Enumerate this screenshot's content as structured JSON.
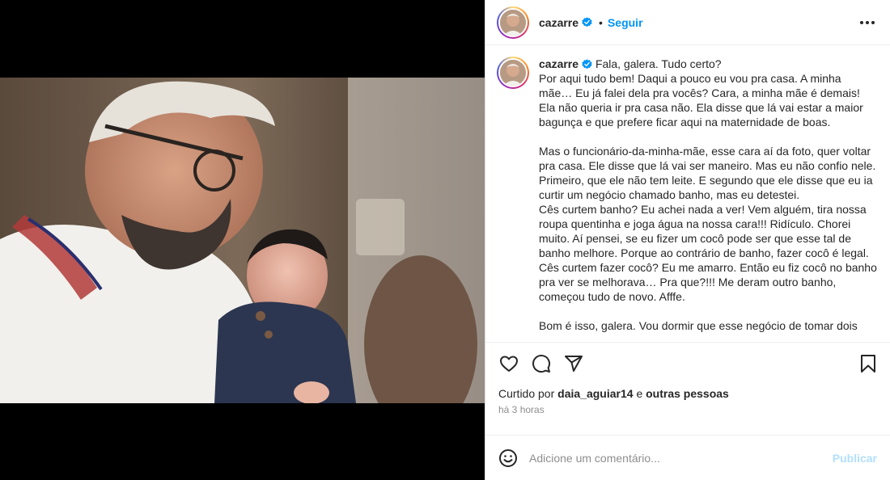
{
  "post": {
    "username": "cazarre",
    "follow_label": "Seguir",
    "separator": "•",
    "caption_username": "cazarre",
    "caption_lines": [
      {
        "text": "Fala, galera. Tudo certo?",
        "inline": true
      },
      {
        "text": "Por aqui tudo bem! Daqui a pouco eu vou pra casa. A minha mãe… Eu já falei dela pra vocês? Cara, a minha mãe é demais! Ela não queria ir pra casa não. Ela disse que lá vai estar a maior bagunça e que prefere ficar aqui na maternidade de boas."
      },
      {
        "text": "Mas o funcionário-da-minha-mãe, esse cara aí da foto, quer voltar pra casa. Ele disse que lá vai ser maneiro. Mas eu não confio nele. Primeiro, que ele não tem leite. E segundo que ele disse que eu ia curtir um negócio chamado banho, mas eu detestei.",
        "gap": true
      },
      {
        "text": "Cês curtem banho? Eu achei nada a ver! Vem alguém, tira nossa roupa quentinha e joga água na nossa cara!!! Ridículo. Chorei muito. Aí pensei, se eu fizer um cocô pode ser que esse tal de banho melhore. Porque ao contrário de banho, fazer cocô é legal. Cês curtem fazer cocô? Eu me amarro. Então eu fiz cocô no banho pra ver se melhorava… Pra que?!!! Me deram outro banho, começou tudo de novo. Afffe."
      },
      {
        "text": "Bom é isso, galera. Vou dormir que esse negócio de tomar dois",
        "gap": true
      }
    ],
    "likes_prefix": "Curtido por",
    "likes_user": "daia_aguiar14",
    "likes_and": "e",
    "likes_others": "outras pessoas",
    "time_ago": "há 3 horas",
    "comment_placeholder": "Adicione um comentário...",
    "publish_label": "Publicar"
  },
  "colors": {
    "accent": "#0095f6",
    "publish_disabled": "#b2dffc",
    "verified": "#0095f6"
  },
  "icons": [
    "more-options-icon",
    "verified-badge-icon",
    "heart-icon",
    "comment-icon",
    "share-icon",
    "bookmark-icon",
    "emoji-icon"
  ]
}
